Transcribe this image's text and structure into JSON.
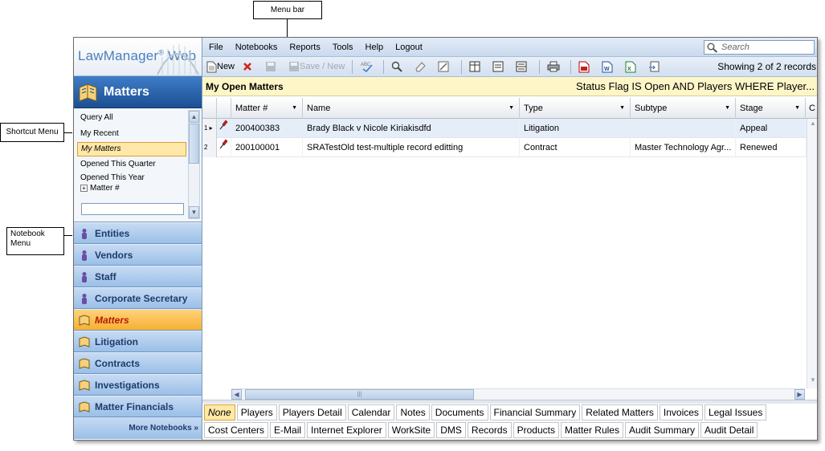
{
  "callouts": {
    "menu_bar": "Menu bar",
    "shortcut_menu": "Shortcut Menu",
    "notebook_menu": "Notebook Menu"
  },
  "logo": {
    "text": "LawManager",
    "reg": "®",
    "suffix": " Web"
  },
  "left": {
    "header": "Matters",
    "shortcuts": [
      "Query All",
      "My Recent",
      "My Matters",
      "Opened This Quarter",
      "Opened This Year"
    ],
    "selected_shortcut": "My Matters",
    "tree_item": "Matter #",
    "notebooks": [
      "Entities",
      "Vendors",
      "Staff",
      "Corporate Secretary",
      "Matters",
      "Litigation",
      "Contracts",
      "Investigations",
      "Matter Financials"
    ],
    "active_notebook": "Matters",
    "more": "More Notebooks »"
  },
  "menubar": {
    "items": [
      "File",
      "Notebooks",
      "Reports",
      "Tools",
      "Help",
      "Logout"
    ],
    "search_placeholder": "Search"
  },
  "toolbar": {
    "new_label": "New",
    "save_new_label": "Save / New",
    "showing": "Showing 2 of 2 records"
  },
  "view": {
    "title": "My Open Matters",
    "filter": "Status Flag IS Open AND Players WHERE Player..."
  },
  "grid": {
    "columns": [
      "Matter #",
      "Name",
      "Type",
      "Subtype",
      "Stage",
      "C"
    ],
    "rows": [
      {
        "num": "1",
        "matter": "200400383",
        "name": "Brady Black v Nicole Kiriakisdfd",
        "type": "Litigation",
        "subtype": "",
        "stage": "Appeal"
      },
      {
        "num": "2",
        "matter": "200100001",
        "name": "SRATestOld test-multiple record editting",
        "type": "Contract",
        "subtype": "Master Technology Agr...",
        "stage": "Renewed"
      }
    ]
  },
  "tabs_row1": [
    "None",
    "Players",
    "Players Detail",
    "Calendar",
    "Notes",
    "Documents",
    "Financial Summary",
    "Related Matters",
    "Invoices",
    "Legal Issues"
  ],
  "tabs_row2": [
    "Cost Centers",
    "E-Mail",
    "Internet Explorer",
    "WorkSite",
    "DMS",
    "Records",
    "Products",
    "Matter Rules",
    "Audit Summary",
    "Audit Detail"
  ],
  "active_tab": "None",
  "colors": {
    "accent": "#1b4f93",
    "active_notebook": "#f7b033",
    "title_bg": "#fff6c8"
  }
}
